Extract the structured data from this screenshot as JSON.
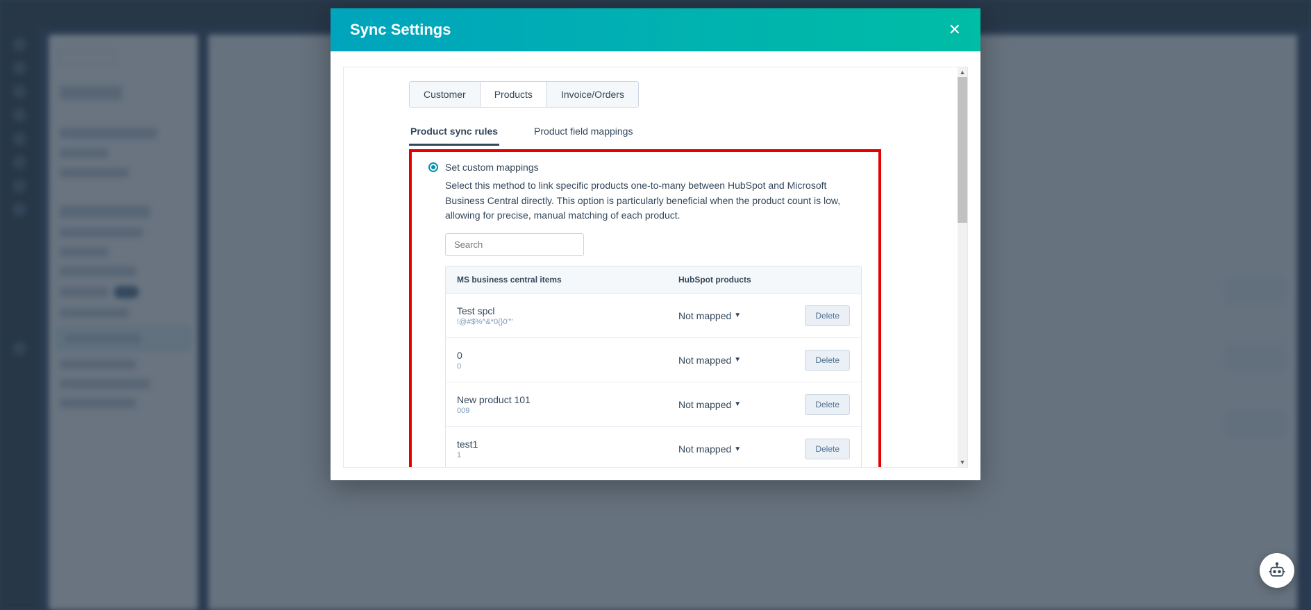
{
  "modal": {
    "title": "Sync Settings"
  },
  "tabs_primary": [
    {
      "label": "Customer"
    },
    {
      "label": "Products"
    },
    {
      "label": "Invoice/Orders"
    }
  ],
  "tabs_secondary": [
    {
      "label": "Product sync rules"
    },
    {
      "label": "Product field mappings"
    }
  ],
  "option": {
    "title": "Set custom mappings",
    "description": "Select this method to link specific products one-to-many between HubSpot and Microsoft Business Central directly. This option is particularly beneficial when the product count is low, allowing for precise, manual matching of each product."
  },
  "search": {
    "placeholder": "Search"
  },
  "table": {
    "col1": "MS business central items",
    "col2": "HubSpot products",
    "not_mapped": "Not mapped",
    "delete": "Delete",
    "rows": [
      {
        "name": "Test spcl",
        "sub": "!@#$%^&*0{}0\"\""
      },
      {
        "name": "0",
        "sub": "0"
      },
      {
        "name": "New product 101",
        "sub": "009"
      },
      {
        "name": "test1",
        "sub": "1"
      }
    ]
  }
}
